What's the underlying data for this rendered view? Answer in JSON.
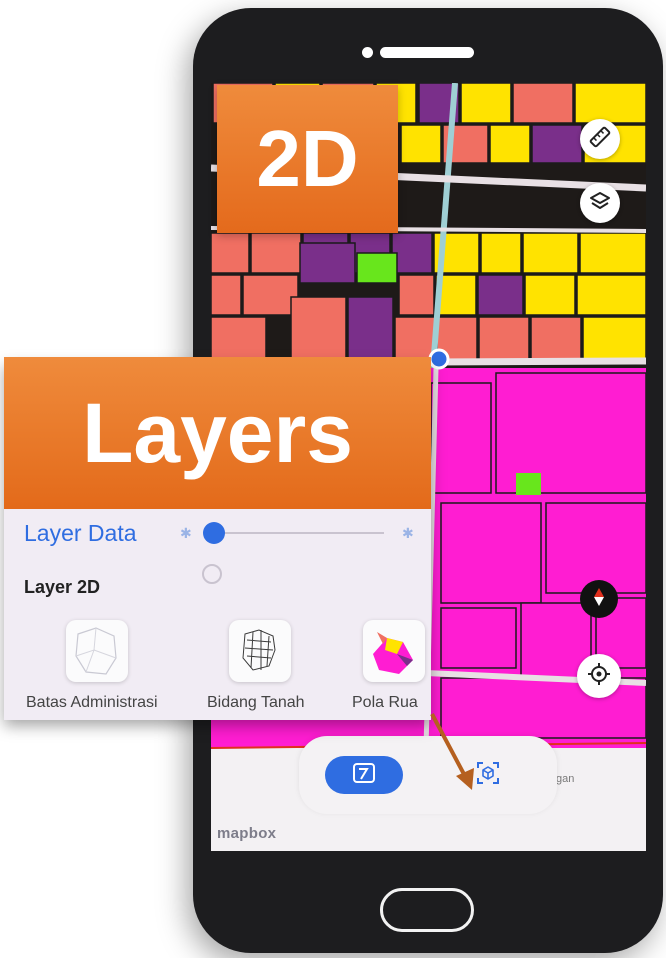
{
  "tags": {
    "two_d": "2D",
    "layers": "Layers"
  },
  "panel": {
    "title": "Layer Data",
    "opacity": 0.05,
    "section_title": "Layer 2D",
    "items": [
      {
        "label": "Batas Administrasi",
        "icon": "boundary-map-icon"
      },
      {
        "label": "Bidang Tanah",
        "icon": "land-parcel-map-icon"
      },
      {
        "label": "Pola Rua",
        "icon": "spatial-pattern-map-icon"
      }
    ]
  },
  "map": {
    "attribution": "mapbox",
    "label_partial": "gan",
    "colors": {
      "residential": "#ffe300",
      "commercial": "#f06f62",
      "industrial": "#7a2f8a",
      "public": "#ff1dd2",
      "green": "#68e61c"
    }
  },
  "toolbar": {
    "active_mode": "2D",
    "mode_2d_icon": "2d-map-icon",
    "mode_3d_icon": "3d-cube-icon"
  },
  "colors": {
    "accent": "#2f6de1",
    "tag": "#e8741f"
  }
}
